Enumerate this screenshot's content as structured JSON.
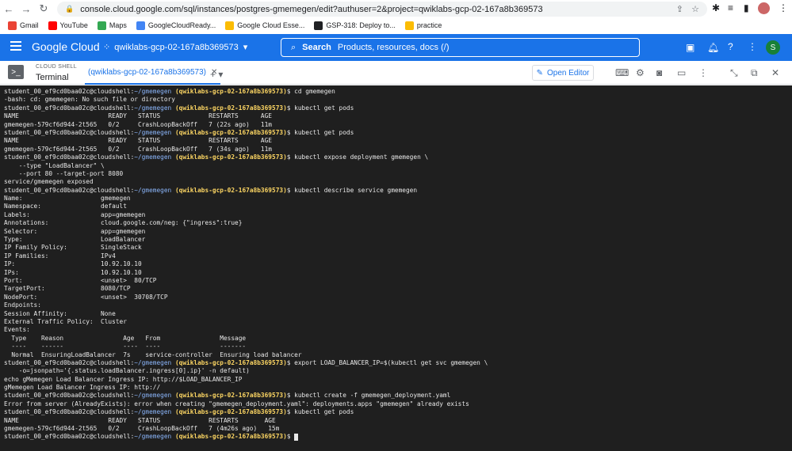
{
  "browser": {
    "url": "console.cloud.google.com/sql/instances/postgres-gmemegen/edit?authuser=2&project=qwiklabs-gcp-02-167a8b369573",
    "bookmarks": [
      {
        "label": "Gmail",
        "color": "#ea4335"
      },
      {
        "label": "YouTube",
        "color": "#ff0000"
      },
      {
        "label": "Maps",
        "color": "#34a853"
      },
      {
        "label": "GoogleCloudReady...",
        "color": "#4285f4"
      },
      {
        "label": "Google Cloud Esse...",
        "color": "#fbbc04"
      },
      {
        "label": "GSP-318: Deploy to...",
        "color": "#202124"
      },
      {
        "label": "practice",
        "color": "#fbbc04"
      }
    ]
  },
  "header": {
    "logo": "Google Cloud",
    "project": "qwiklabs-gcp-02-167a8b369573",
    "search_label": "Search",
    "search_placeholder": "Products, resources, docs (/)",
    "avatar_letter": "S"
  },
  "shell": {
    "section": "CLOUD SHELL",
    "title": "Terminal",
    "tab_label": "(qwiklabs-gcp-02-167a8b369573)",
    "tab_close": "✕",
    "add_tab": "+ ▾",
    "open_editor": "Open Editor"
  },
  "terminal": {
    "prompt_user": "student_00_ef9cd0baa02c@cloudshell:",
    "prompt_path": "~/gmemegen",
    "prompt_proj": "(qwiklabs-gcp-02-167a8b369573)",
    "lines": [
      {
        "cmd": "cd gmemegen"
      },
      {
        "text": "-bash: cd: gmemegen: No such file or directory"
      },
      {
        "cmd": "kubectl get pods"
      },
      {
        "text": "NAME                        READY   STATUS             RESTARTS      AGE"
      },
      {
        "text": "gmemegen-579cf6d944-2t565   0/2     CrashLoopBackOff   7 (22s ago)   11m"
      },
      {
        "cmd": "kubectl get pods"
      },
      {
        "text": "NAME                        READY   STATUS             RESTARTS      AGE"
      },
      {
        "text": "gmemegen-579cf6d944-2t565   0/2     CrashLoopBackOff   7 (34s ago)   11m"
      },
      {
        "cmd": "kubectl expose deployment gmemegen \\"
      },
      {
        "text": "    --type \"LoadBalancer\" \\"
      },
      {
        "text": "    --port 80 --target-port 8080"
      },
      {
        "text": "service/gmemegen exposed"
      },
      {
        "cmd": "kubectl describe service gmemegen"
      },
      {
        "text": "Name:                     gmemegen"
      },
      {
        "text": "Namespace:                default"
      },
      {
        "text": "Labels:                   app=gmemegen"
      },
      {
        "text": "Annotations:              cloud.google.com/neg: {\"ingress\":true}"
      },
      {
        "text": "Selector:                 app=gmemegen"
      },
      {
        "text": "Type:                     LoadBalancer"
      },
      {
        "text": "IP Family Policy:         SingleStack"
      },
      {
        "text": "IP Families:              IPv4"
      },
      {
        "text": "IP:                       10.92.10.10"
      },
      {
        "text": "IPs:                      10.92.10.10"
      },
      {
        "text": "Port:                     <unset>  80/TCP"
      },
      {
        "text": "TargetPort:               8080/TCP"
      },
      {
        "text": "NodePort:                 <unset>  30708/TCP"
      },
      {
        "text": "Endpoints:"
      },
      {
        "text": "Session Affinity:         None"
      },
      {
        "text": "External Traffic Policy:  Cluster"
      },
      {
        "text": "Events:"
      },
      {
        "text": "  Type    Reason                Age   From                Message"
      },
      {
        "text": "  ----    ------                ----  ----                -------"
      },
      {
        "text": "  Normal  EnsuringLoadBalancer  7s    service-controller  Ensuring load balancer"
      },
      {
        "cmd": "export LOAD_BALANCER_IP=$(kubectl get svc gmemegen \\"
      },
      {
        "text": "    -o=jsonpath='{.status.loadBalancer.ingress[0].ip}' -n default)"
      },
      {
        "text": "echo gMemegen Load Balancer Ingress IP: http://$LOAD_BALANCER_IP"
      },
      {
        "text": "gMemegen Load Balancer Ingress IP: http://"
      },
      {
        "cmd": "kubectl create -f gmemegen_deployment.yaml"
      },
      {
        "text": "Error from server (AlreadyExists): error when creating \"gmemegen_deployment.yaml\": deployments.apps \"gmemegen\" already exists"
      },
      {
        "cmd": "kubectl get pods"
      },
      {
        "text": "NAME                        READY   STATUS             RESTARTS       AGE"
      },
      {
        "text": "gmemegen-579cf6d944-2t565   0/2     CrashLoopBackOff   7 (4m26s ago)   15m"
      },
      {
        "cmd": "",
        "cursor": true
      }
    ]
  }
}
